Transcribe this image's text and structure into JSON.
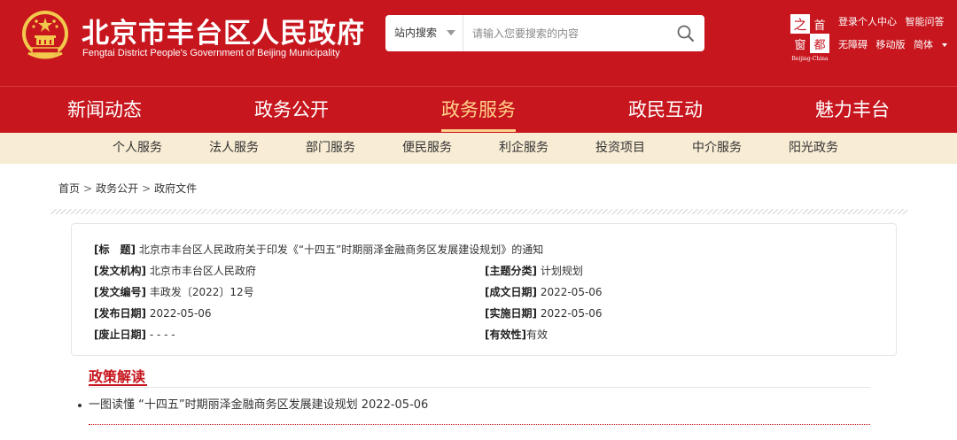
{
  "header": {
    "title": "北京市丰台区人民政府",
    "subtitle": "Fengtai District People's Government of Beijing Municipality",
    "search": {
      "scope": "站内搜索",
      "placeholder": "请输入您要搜索的内容"
    },
    "capital_logo": {
      "chars": [
        "之",
        "首",
        "窗",
        "都"
      ],
      "caption": "Beijing-China"
    },
    "links_row1": [
      "登录个人中心",
      "智能问答"
    ],
    "links_row2": [
      "无障碍",
      "移动版",
      "简体"
    ]
  },
  "main_nav": [
    {
      "label": "新闻动态",
      "active": false
    },
    {
      "label": "政务公开",
      "active": false
    },
    {
      "label": "政务服务",
      "active": true
    },
    {
      "label": "政民互动",
      "active": false
    },
    {
      "label": "魅力丰台",
      "active": false
    }
  ],
  "sub_nav": [
    "个人服务",
    "法人服务",
    "部门服务",
    "便民服务",
    "利企服务",
    "投资项目",
    "中介服务",
    "阳光政务"
  ],
  "breadcrumb": [
    "首页",
    "政务公开",
    "政府文件"
  ],
  "breadcrumb_sep": ">",
  "document": {
    "title_label": "[标　题]",
    "title_value": "北京市丰台区人民政府关于印发《“十四五”时期丽泽金融商务区发展建设规划》的通知",
    "issuer_label": "[发文机构]",
    "issuer_value": "北京市丰台区人民政府",
    "topic_label": "[主题分类]",
    "topic_value": "计划规划",
    "doc_no_label": "[发文编号]",
    "doc_no_value": "丰政发〔2022〕12号",
    "written_label": "[成文日期]",
    "written_value": "2022-05-06",
    "publish_label": "[发布日期]",
    "publish_value": "2022-05-06",
    "effective_label": "[实施日期]",
    "effective_value": "2022-05-06",
    "repeal_label": "[废止日期]",
    "repeal_value": "- - - -",
    "validity_label": "[有效性]",
    "validity_value": "有效"
  },
  "policy": {
    "heading": "政策解读",
    "items": [
      {
        "text": "一图读懂 “十四五”时期丽泽金融商务区发展建设规划",
        "date": "2022-05-06"
      }
    ]
  },
  "colors": {
    "brand_red": "#c7161e",
    "active_gold": "#ffd18a",
    "subnav_bg": "#f8ecd4"
  }
}
